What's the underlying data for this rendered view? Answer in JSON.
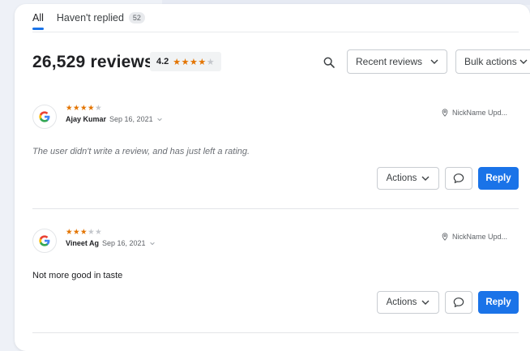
{
  "tabs": [
    {
      "label": "All"
    },
    {
      "label": "Haven't replied",
      "count": "52"
    }
  ],
  "header": {
    "review_count": "26,529 reviews",
    "average_rating": "4.2",
    "rating_stars": 4.2,
    "sort_dropdown": "Recent reviews",
    "bulk_dropdown": "Bulk actions"
  },
  "reviews": [
    {
      "stars": 4,
      "author": "Ajay Kumar",
      "date": "Sep 16, 2021",
      "location": "NickName Upd...",
      "text": "The user didn't write a review, and has just left a rating.",
      "actions_label": "Actions",
      "reply_label": "Reply"
    },
    {
      "stars": 3,
      "author": "Vineet Ag",
      "date": "Sep 16, 2021",
      "location": "NickName Upd...",
      "text": "Not more good in taste",
      "actions_label": "Actions",
      "reply_label": "Reply"
    }
  ],
  "colors": {
    "accent": "#1a73e8",
    "star": "#e37400",
    "star_off": "#c4c7cc"
  },
  "icons": [
    "search-icon",
    "chevron-down-icon",
    "google-g-icon",
    "location-pin-icon",
    "comment-icon",
    "caret-down-icon"
  ]
}
